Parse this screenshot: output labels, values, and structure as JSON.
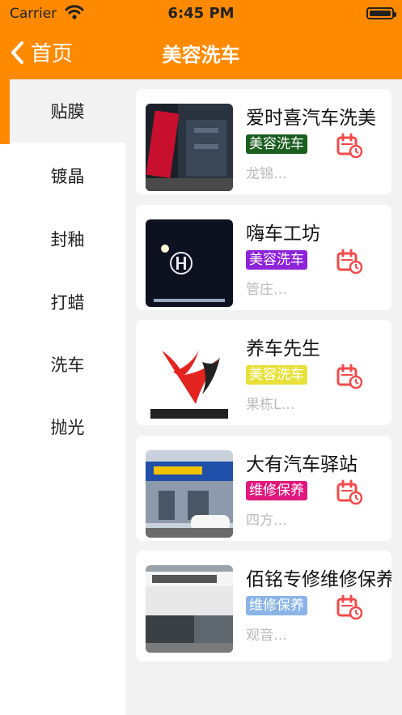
{
  "status_bar": {
    "carrier": "Carrier",
    "time": "6:45 PM"
  },
  "nav": {
    "back_label": "首页",
    "title": "美容洗车"
  },
  "colors": {
    "brand": "#ff8a00"
  },
  "sidebar": {
    "items": [
      {
        "label": "贴膜",
        "active": true
      },
      {
        "label": "镀晶"
      },
      {
        "label": "封釉"
      },
      {
        "label": "打蜡"
      },
      {
        "label": "洗车"
      },
      {
        "label": "抛光"
      }
    ]
  },
  "shops": [
    {
      "name": "爱时喜汽车洗美",
      "tag": "美容洗车",
      "tag_color": "#1b5e20",
      "address": "龙锦…",
      "image": "storefront with red sign"
    },
    {
      "name": " 嗨车工坊",
      "tag": "美容洗车",
      "tag_color": "#8e24d9",
      "address": "管庄…",
      "image": "night storefront Hi Car logo"
    },
    {
      "name": "养车先生",
      "tag": "美容洗车",
      "tag_color": "#e8e03a",
      "address": "果栋L…",
      "image": "养车先生 logo"
    },
    {
      "name": "大有汽车驿站",
      "tag": "维修保养",
      "tag_color": "#e0177c",
      "address": "四方…",
      "image": "storefront with blue sign"
    },
    {
      "name": " 佰铭专修维修保养",
      "tag": "维修保养",
      "tag_color": "#8ab4e8",
      "address": "观音…",
      "image": "storefront with brand signs"
    }
  ]
}
